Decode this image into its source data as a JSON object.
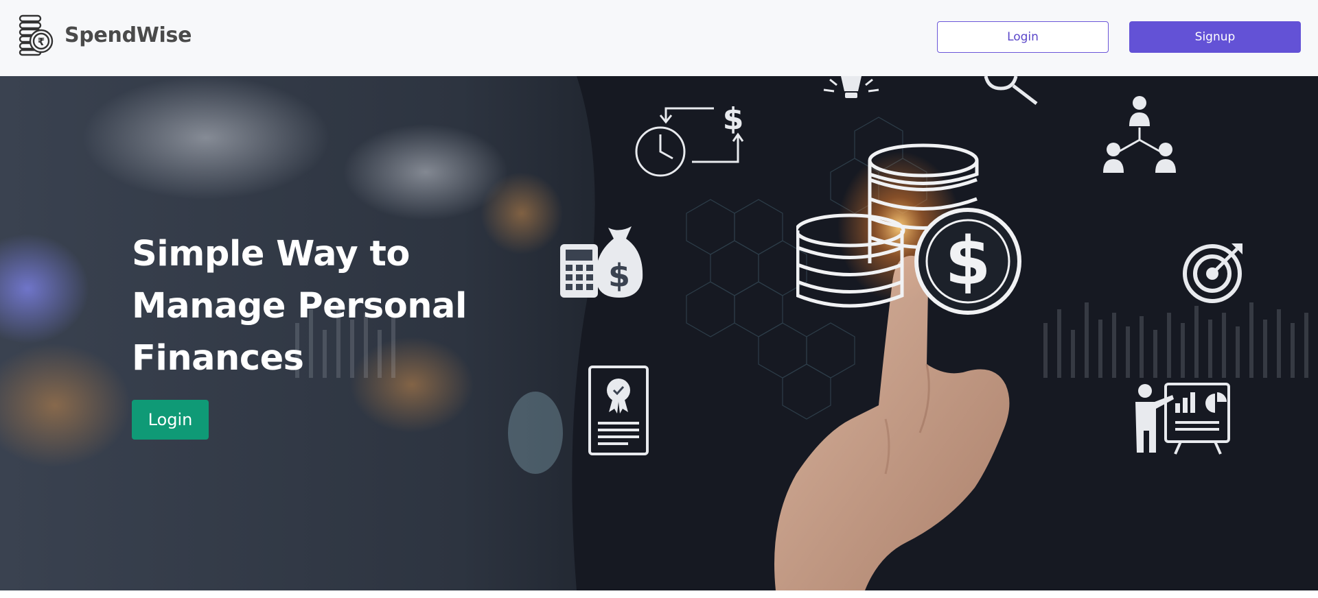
{
  "brand": {
    "name": "SpendWise",
    "logo_icon": "coin-stack-rupee-icon"
  },
  "nav": {
    "login_label": "Login",
    "signup_label": "Signup"
  },
  "hero": {
    "title": "Simple Way to Manage Personal Finances",
    "login_label": "Login",
    "background_image": "hand-touching-glowing-coin-stack-with-finance-icons",
    "icons": [
      "clock-dollar-cycle-icon",
      "lightbulb-icon",
      "magnifier-icon",
      "org-chart-people-icon",
      "calculator-money-bag-icon",
      "coin-stacks-dollar-icon",
      "target-arrow-icon",
      "certificate-document-icon",
      "presenter-chart-icon"
    ]
  },
  "colors": {
    "brand_text": "#4a4a4a",
    "nav_bg": "#f7f8fa",
    "primary_purple": "#6352d6",
    "hero_button_green": "#0f9a76",
    "hero_text": "#ffffff"
  }
}
